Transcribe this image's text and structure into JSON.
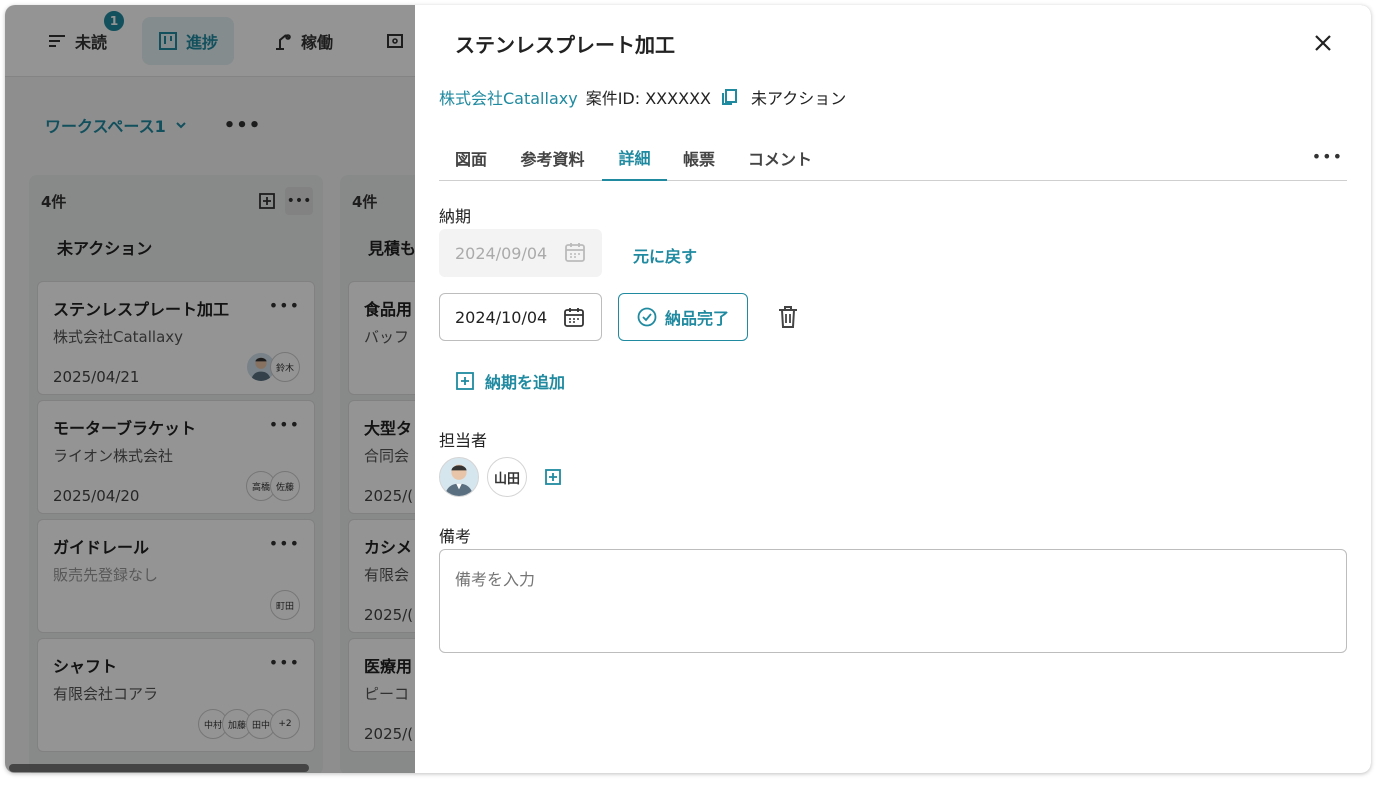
{
  "nav": {
    "unread": {
      "label": "未読",
      "badge": "1",
      "icon": "list-filter-icon"
    },
    "progress": {
      "label": "進捗",
      "icon": "kanban-icon"
    },
    "operation": {
      "label": "稼働",
      "icon": "machine-icon"
    }
  },
  "workspace": {
    "name": "ワークスペース1",
    "more": "•••"
  },
  "columns": [
    {
      "count": "4件",
      "title": "未アクション",
      "cards": [
        {
          "title": "ステンレスプレート加工",
          "company": "株式会社Catallaxy",
          "date": "2025/04/21",
          "assignees": [
            "鈴木"
          ]
        },
        {
          "title": "モーターブラケット",
          "company": "ライオン株式会社",
          "date": "2025/04/20",
          "assignees": [
            "高橋",
            "佐藤"
          ]
        },
        {
          "title": "ガイドレール",
          "company": "販売先登録なし",
          "date": "",
          "assignees": [
            "町田"
          ]
        },
        {
          "title": "シャフト",
          "company": "有限会社コアラ",
          "date": "",
          "assignees": [
            "中村",
            "加藤",
            "田中",
            "+2"
          ]
        }
      ]
    },
    {
      "count": "4件",
      "title": "見積も",
      "cards": [
        {
          "title": "食品用",
          "company": "バッフ",
          "date": ""
        },
        {
          "title": "大型タ",
          "company": "合同会",
          "date": "2025/("
        },
        {
          "title": "カシメ",
          "company": "有限会",
          "date": "2025/("
        },
        {
          "title": "医療用",
          "company": "ピーコ",
          "date": "2025/("
        }
      ]
    }
  ],
  "panel": {
    "title": "ステンレスプレート加工",
    "company_link": "株式会社Catallaxy",
    "case_id": "案件ID: XXXXXX",
    "status": "未アクション",
    "tabs": [
      "図面",
      "参考資料",
      "詳細",
      "帳票",
      "コメント"
    ],
    "active_tab": "詳細",
    "tab_more": "•••",
    "due": {
      "label": "納期",
      "old_date": "2024/09/04",
      "revert_label": "元に戻す",
      "new_date": "2024/10/04",
      "done_label": "納品完了",
      "add_label": "納期を追加"
    },
    "assignee": {
      "label": "担当者",
      "names": [
        "山田"
      ]
    },
    "notes": {
      "label": "備考",
      "placeholder": "備考を入力"
    }
  },
  "colors": {
    "accent": "#1f8aa0",
    "overlay": "rgba(0,0,0,0.42)"
  }
}
